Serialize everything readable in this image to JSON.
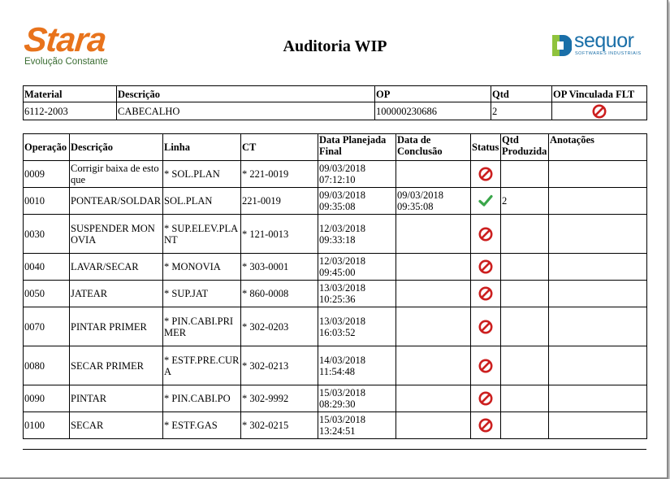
{
  "header": {
    "title": "Auditoria WIP",
    "left_logo": {
      "brand": "Stara",
      "tagline": "Evolução Constante",
      "color": "#e8731c"
    },
    "right_logo": {
      "brand": "sequor",
      "tagline": "SOFTWARES INDUSTRIAIS",
      "color": "#1a6fa8"
    }
  },
  "summary": {
    "headers": {
      "material": "Material",
      "descricao": "Descrição",
      "op": "OP",
      "qtd": "Qtd",
      "op_vinculada": "OP Vinculada FLT"
    },
    "values": {
      "material": "6112-2003",
      "descricao": "CABECALHO",
      "op": "100000230686",
      "qtd": "2",
      "op_vinculada_icon": "prohibited-icon"
    }
  },
  "operations": {
    "headers": {
      "operacao": "Operação",
      "descricao": "Descrição",
      "linha": "Linha",
      "ct": "CT",
      "data_planejada": "Data Planejada Final",
      "data_conclusao": "Data de Conclusão",
      "status": "Status",
      "qtd_produzida": "Qtd Produzida",
      "anotacoes": "Anotações"
    },
    "rows": [
      {
        "operacao": "0009",
        "descricao": "Corrigir baixa de estoque",
        "linha": "* SOL.PLAN",
        "ct": "* 221-0019",
        "data_planejada": "09/03/2018 07:12:10",
        "data_conclusao": "",
        "status": "prohibited",
        "qtd_produzida": "",
        "anotacoes": ""
      },
      {
        "operacao": "0010",
        "descricao": "PONTEAR/SOLDAR",
        "linha": "SOL.PLAN",
        "ct": "221-0019",
        "data_planejada": "09/03/2018 09:35:08",
        "data_conclusao": "09/03/2018 09:35:08",
        "status": "done",
        "qtd_produzida": "2",
        "anotacoes": ""
      },
      {
        "operacao": "0030",
        "descricao": "SUSPENDER MONOVIA",
        "linha": "* SUP.ELEV.PLANT",
        "ct": "* 121-0013",
        "data_planejada": "12/03/2018 09:33:18",
        "data_conclusao": "",
        "status": "prohibited",
        "qtd_produzida": "",
        "anotacoes": ""
      },
      {
        "operacao": "0040",
        "descricao": "LAVAR/SECAR",
        "linha": "* MONOVIA",
        "ct": "* 303-0001",
        "data_planejada": "12/03/2018 09:45:00",
        "data_conclusao": "",
        "status": "prohibited",
        "qtd_produzida": "",
        "anotacoes": ""
      },
      {
        "operacao": "0050",
        "descricao": "JATEAR",
        "linha": "* SUP.JAT",
        "ct": "* 860-0008",
        "data_planejada": "13/03/2018 10:25:36",
        "data_conclusao": "",
        "status": "prohibited",
        "qtd_produzida": "",
        "anotacoes": ""
      },
      {
        "operacao": "0070",
        "descricao": "PINTAR PRIMER",
        "linha": "* PIN.CABI.PRIMER",
        "ct": "* 302-0203",
        "data_planejada": "13/03/2018 16:03:52",
        "data_conclusao": "",
        "status": "prohibited",
        "qtd_produzida": "",
        "anotacoes": ""
      },
      {
        "operacao": "0080",
        "descricao": "SECAR PRIMER",
        "linha": "* ESTF.PRE.CURA",
        "ct": "* 302-0213",
        "data_planejada": "14/03/2018 11:54:48",
        "data_conclusao": "",
        "status": "prohibited",
        "qtd_produzida": "",
        "anotacoes": ""
      },
      {
        "operacao": "0090",
        "descricao": "PINTAR",
        "linha": "* PIN.CABI.PO",
        "ct": "* 302-9992",
        "data_planejada": "15/03/2018 08:29:30",
        "data_conclusao": "",
        "status": "prohibited",
        "qtd_produzida": "",
        "anotacoes": ""
      },
      {
        "operacao": "0100",
        "descricao": "SECAR",
        "linha": "* ESTF.GAS",
        "ct": "* 302-0215",
        "data_planejada": "15/03/2018 13:24:51",
        "data_conclusao": "",
        "status": "prohibited",
        "qtd_produzida": "",
        "anotacoes": ""
      }
    ]
  },
  "status_colors": {
    "prohibited": "#cc1f1f",
    "done": "#3aa64a"
  }
}
